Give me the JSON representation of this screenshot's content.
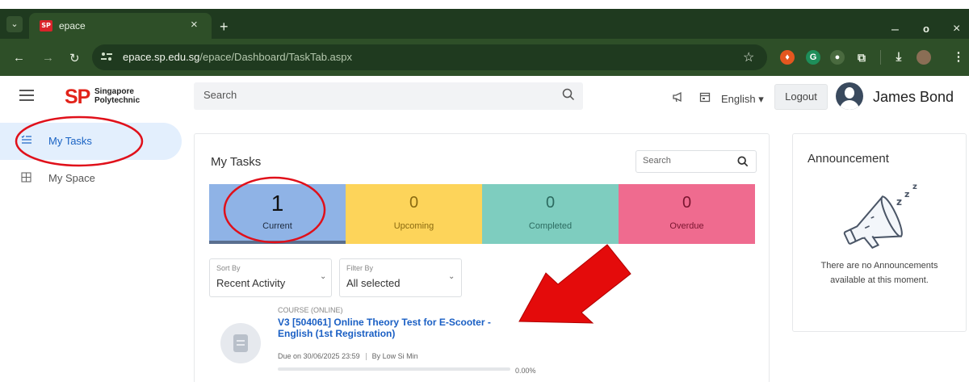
{
  "browser": {
    "tab_title": "epace",
    "favicon_text": "SP",
    "tab_close": "×",
    "new_tab": "+",
    "url_domain": "epace.sp.edu.sg",
    "url_path": "/epace/Dashboard/TaskTab.aspx",
    "window_minimize": "–",
    "window_maximize": "o",
    "window_close": "×"
  },
  "header": {
    "logo_mark": "SP",
    "logo_name_line1": "Singapore",
    "logo_name_line2": "Polytechnic",
    "search_placeholder": "Search",
    "language": "English ▾",
    "logout_label": "Logout",
    "user_name": "James Bond"
  },
  "sidebar": {
    "items": [
      {
        "label": "My Tasks",
        "icon": "task-list-icon",
        "active": true
      },
      {
        "label": "My Space",
        "icon": "grid-icon",
        "active": false
      }
    ]
  },
  "tasks": {
    "title": "My Tasks",
    "search_placeholder": "Search",
    "tiles": [
      {
        "count": "1",
        "label": "Current",
        "color": "#8fb3e6"
      },
      {
        "count": "0",
        "label": "Upcoming",
        "color": "#fdd45a"
      },
      {
        "count": "0",
        "label": "Completed",
        "color": "#7ecdbf"
      },
      {
        "count": "0",
        "label": "Overdue",
        "color": "#ef6b8f"
      }
    ],
    "sort": {
      "label": "Sort By",
      "value": "Recent Activity"
    },
    "filter": {
      "label": "Filter By",
      "value": "All selected"
    },
    "items": [
      {
        "type": "COURSE (ONLINE)",
        "title": "V3 [504061] Online Theory Test for E-Scooter - English (1st Registration)",
        "due": "Due on 30/06/2025 23:59",
        "author": "By Low Si Min",
        "progress_text": "0.00%",
        "progress": 0.0
      }
    ]
  },
  "announcement": {
    "title": "Announcement",
    "empty_text": "There are no Announcements available at this moment."
  },
  "colors": {
    "brand_red": "#e2231a",
    "link_blue": "#1a5fc4",
    "annotation_red": "#e0101a"
  }
}
